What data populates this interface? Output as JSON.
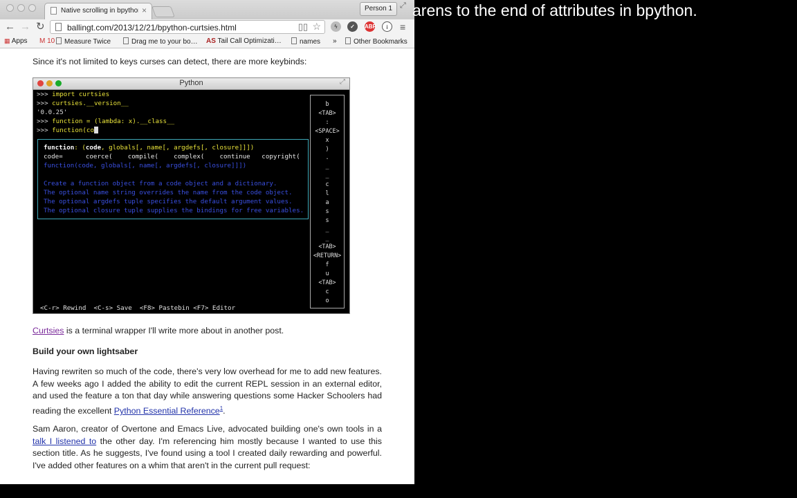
{
  "browser": {
    "tab_title": "Native scrolling in bpython",
    "profile_label": "Person 1",
    "url": "ballingt.com/2013/12/21/bpython-curtsies.html",
    "extensions": [
      {
        "name": "extension-icon",
        "label": ""
      },
      {
        "name": "pocket-icon",
        "label": ""
      },
      {
        "name": "adblock-icon",
        "label": "ABP"
      },
      {
        "name": "info-icon",
        "label": "ⓘ"
      }
    ],
    "bookmarks": [
      "Apps",
      "M 10",
      "Measure Twice",
      "Drag me to your bo…",
      "Tail Call Optimizati…",
      "names",
      "»",
      "Other Bookmarks"
    ]
  },
  "article": {
    "intro_line": "Since it's not limited to keys curses can detect, there are more keybinds:",
    "curtsies_link": "Curtsies",
    "curtsies_rest": " is a terminal wrapper I'll write more about in another post.",
    "heading": "Build your own lightsaber",
    "para1_text": "Having rewriten so much of the code, there's very low overhead for me to add new features. A few weeks ago I added the ability to edit the current REPL session in an external editor, and used the feature a ton that day while answering questions some Hacker Schoolers had reading the excellent ",
    "para1_link": "Python Essential Reference",
    "para1_sup": "1",
    "para1_end": ".",
    "para2_text_a": "Sam Aaron, creator of Overtone and Emacs Live, advocated building one's own tools in a ",
    "para2_link": "talk I listened to",
    "para2_text_b": " the other day. I'm referencing him mostly because I wanted to use this section title. As he suggests, I've found using a tool I created daily rewarding and powerful. I've added other features on a whim that aren't in the current pull request:"
  },
  "terminal": {
    "title": "Python",
    "lines": [
      {
        "prompt": ">>> ",
        "code": "import curtsies"
      },
      {
        "prompt": ">>> ",
        "code": "curtsies.__version__"
      },
      {
        "prompt": "",
        "code": "'0.0.25'"
      },
      {
        "prompt": ">>> ",
        "code": "function = (lambda: x).__class__"
      },
      {
        "prompt": ">>> ",
        "code": "function(co"
      }
    ],
    "popup": {
      "sig_name": "function",
      "sig_rest": ": (",
      "sig_arg": "code",
      "sig_tail": ", globals[, name[, argdefs[, closure]]])",
      "completions": "code=      coerce(    compile(    complex(    continue   copyright(",
      "doc_sig": "function(code, globals[, name[, argdefs[, closure]]])",
      "doc_lines": [
        "Create a function object from a code object and a dictionary.",
        "The optional name string overrides the name from the code object.",
        "The optional argdefs tuple specifies the default argument values.",
        "The optional closure tuple supplies the bindings for free variables."
      ]
    },
    "keys": [
      "b",
      "<TAB>",
      ":",
      "<SPACE>",
      "x",
      ")",
      ".",
      "_",
      "_",
      "c",
      "l",
      "a",
      "s",
      "s",
      "_",
      "_",
      "<TAB>",
      "<RETURN>",
      "f",
      "u",
      "<TAB>",
      "c",
      "o"
    ],
    "statusbar": "<C-r> Rewind  <C-s> Save  <F8> Pastebin <F7> Editor"
  },
  "overlay_caption": "arens to the end of attributes in bpython."
}
